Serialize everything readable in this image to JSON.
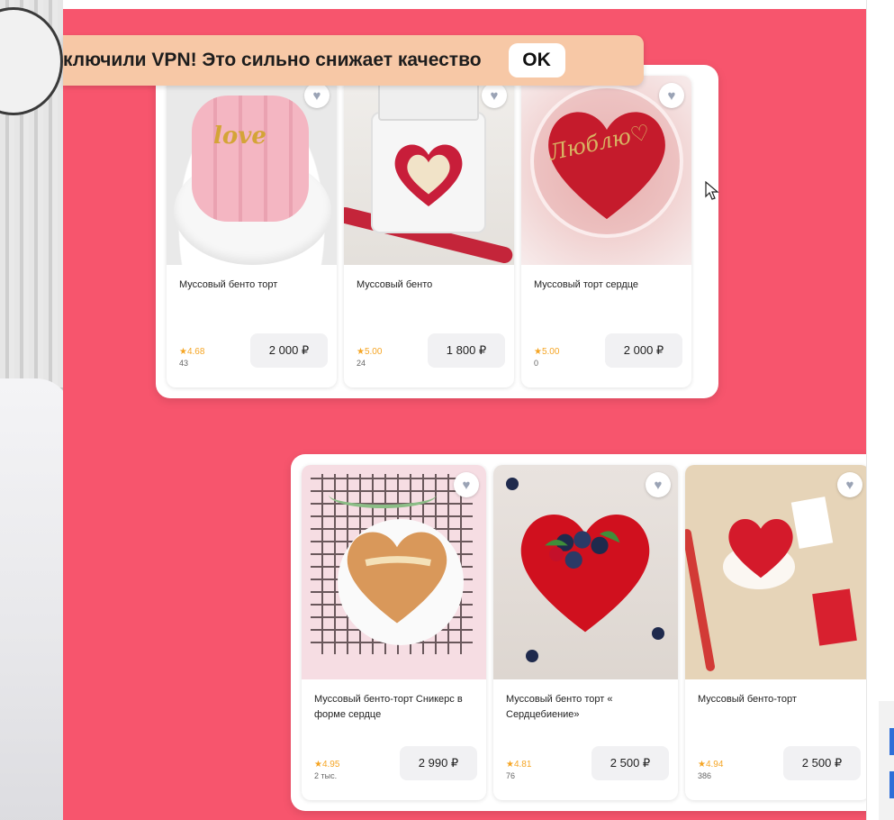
{
  "vpn_banner": {
    "message": "ключили VPN! Это сильно снижает качество",
    "ok_label": "OK"
  },
  "products_top": [
    {
      "name": "Муссовый бенто торт",
      "rating": "★4.68",
      "reviews": "43",
      "price": "2 000 ₽",
      "image": "pink-bento-love-cake"
    },
    {
      "name": "Муссовый бенто",
      "rating": "★5.00",
      "reviews": "24",
      "price": "1 800 ₽",
      "image": "red-heart-bento-in-box"
    },
    {
      "name": "Муссовый торт сердце",
      "rating": "★5.00",
      "reviews": "0",
      "price": "2 000 ₽",
      "image": "red-heart-lyublyu-cake"
    }
  ],
  "products_bottom": [
    {
      "name": "Муссовый бенто-торт Сникерс в форме сердце",
      "rating": "★4.95",
      "reviews": "2 тыс.",
      "price": "2 990 ₽",
      "image": "snickers-heart-cake"
    },
    {
      "name": "Муссовый бенто торт « Сердцебиение»",
      "rating": "★4.81",
      "reviews": "76",
      "price": "2 500 ₽",
      "image": "red-heart-berry-cake"
    },
    {
      "name": "Муссовый бенто-торт",
      "rating": "★4.94",
      "reviews": "386",
      "price": "2 500 ₽",
      "image": "red-heart-lyublyu-mini-cake"
    }
  ],
  "colors": {
    "slide_background": "#f7556d",
    "banner_background": "#f7c8a6",
    "rating_color": "#f5a524",
    "cake_red": "#d8202f"
  },
  "icons": {
    "favorite": "heart-icon",
    "rating": "star-icon",
    "pointer": "mouse-cursor-icon"
  }
}
